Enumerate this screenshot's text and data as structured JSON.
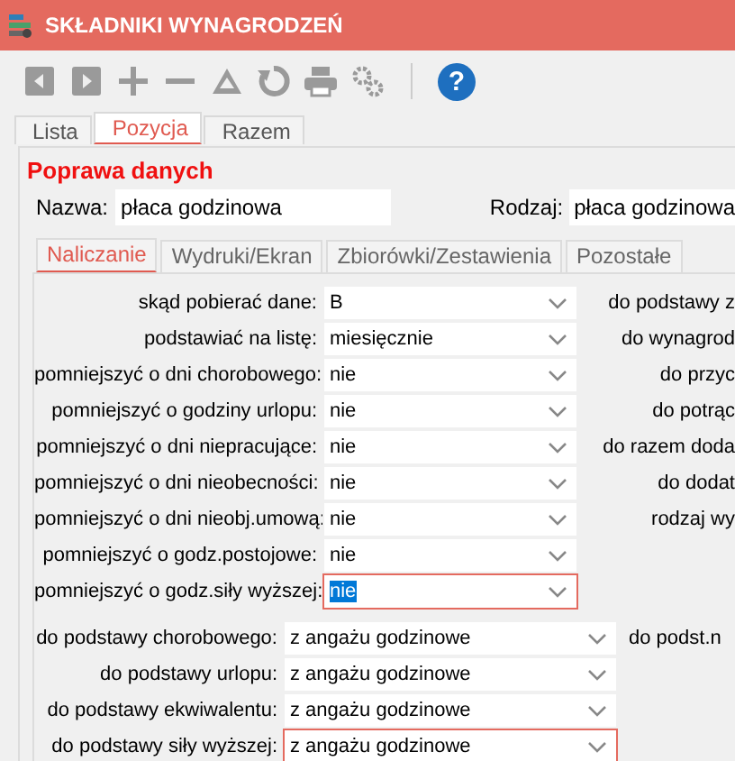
{
  "window": {
    "title": "SKŁADNIKI WYNAGRODZEŃ"
  },
  "toolbar": [
    {
      "kind": "prev",
      "disabled": true
    },
    {
      "kind": "next",
      "disabled": true
    },
    {
      "kind": "add",
      "disabled": true
    },
    {
      "kind": "remove",
      "disabled": true
    },
    {
      "kind": "delta",
      "disabled": true
    },
    {
      "kind": "refresh",
      "disabled": true
    },
    {
      "kind": "print",
      "disabled": true
    },
    {
      "kind": "settings",
      "disabled": true
    },
    {
      "kind": "separator"
    },
    {
      "kind": "help",
      "label": "?",
      "disabled": false
    }
  ],
  "tabs": [
    {
      "label": "Lista",
      "selected": false
    },
    {
      "label": "Pozycja",
      "selected": true
    },
    {
      "label": "Razem",
      "selected": false
    }
  ],
  "section_title": "Poprawa danych",
  "name_field": {
    "label": "Nazwa:",
    "value": "płaca godzinowa"
  },
  "type_field": {
    "label": "Rodzaj:",
    "value": "płaca godzinowa"
  },
  "subtabs": [
    {
      "label": "Naliczanie",
      "selected": true
    },
    {
      "label": "Wydruki/Ekran",
      "selected": false
    },
    {
      "label": "Zbiorówki/Zestawienia",
      "selected": false
    },
    {
      "label": "Pozostałe",
      "selected": false
    }
  ],
  "group1": [
    {
      "label": "skąd pobierać dane:",
      "value": "B",
      "focused": false,
      "outlined": false,
      "right_label": "do podstawy z"
    },
    {
      "label": "podstawiać na listę:",
      "value": "miesięcznie",
      "focused": false,
      "outlined": false,
      "right_label": "do wynagrod"
    },
    {
      "label": "pomniejszyć o dni chorobowego:",
      "value": "nie",
      "focused": false,
      "outlined": false,
      "right_label": "do przyc"
    },
    {
      "label": "pomniejszyć o godziny urlopu:",
      "value": "nie",
      "focused": false,
      "outlined": false,
      "right_label": "do potrąc"
    },
    {
      "label": "pomniejszyć o dni niepracujące:",
      "value": "nie",
      "focused": false,
      "outlined": false,
      "right_label": "do razem doda"
    },
    {
      "label": "pomniejszyć o dni nieobecności:",
      "value": "nie",
      "focused": false,
      "outlined": false,
      "right_label": "do dodat"
    },
    {
      "label": "pomniejszyć o dni nieobj.umową:",
      "value": "nie",
      "focused": false,
      "outlined": false,
      "right_label": "rodzaj wy"
    },
    {
      "label": "pomniejszyć o godz.postojowe:",
      "value": "nie",
      "focused": false,
      "outlined": false
    },
    {
      "label": "pomniejszyć o godz.siły wyższej:",
      "value": "nie",
      "focused": true,
      "outlined": true
    }
  ],
  "group2": [
    {
      "label": "do podstawy chorobowego:",
      "value": "z angażu godzinowe",
      "focused": false,
      "outlined": false,
      "right_label": "do podst.n"
    },
    {
      "label": "do podstawy urlopu:",
      "value": "z angażu godzinowe",
      "focused": false,
      "outlined": false
    },
    {
      "label": "do podstawy ekwiwalentu:",
      "value": "z angażu godzinowe",
      "focused": false,
      "outlined": false
    },
    {
      "label": "do podstawy siły wyższej:",
      "value": "z angażu godzinowe",
      "focused": false,
      "outlined": true
    }
  ]
}
